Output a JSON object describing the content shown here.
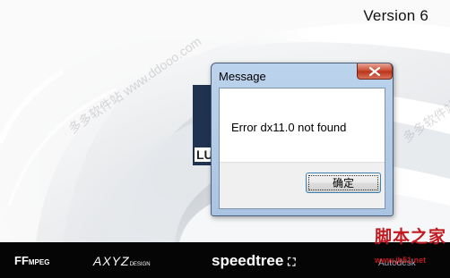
{
  "splash": {
    "version": "Version 6",
    "logo_text": "LU"
  },
  "watermarks": {
    "diag_left": "多多软件站 www.ddooo.com",
    "diag_right": "多多软件站 www.ddooo.com"
  },
  "dialog": {
    "title": "Message",
    "message": "Error dx11.0 not found",
    "ok_label": "确定",
    "close_symbol": "✕"
  },
  "logo_bar": {
    "ffmpeg": "FF",
    "ffmpeg_small": "MPEG",
    "axyz": "AXYZ",
    "axyz_small": "DESIGN",
    "speedtree": "speedtree",
    "autodesk": "Autodesk"
  },
  "site_watermark": {
    "chinese": "脚本之家",
    "url": "www.jb51.net"
  },
  "colors": {
    "dialog_frame": "#bcd3ec",
    "close_button": "#c8472d",
    "site_watermark": "#c0191f"
  }
}
